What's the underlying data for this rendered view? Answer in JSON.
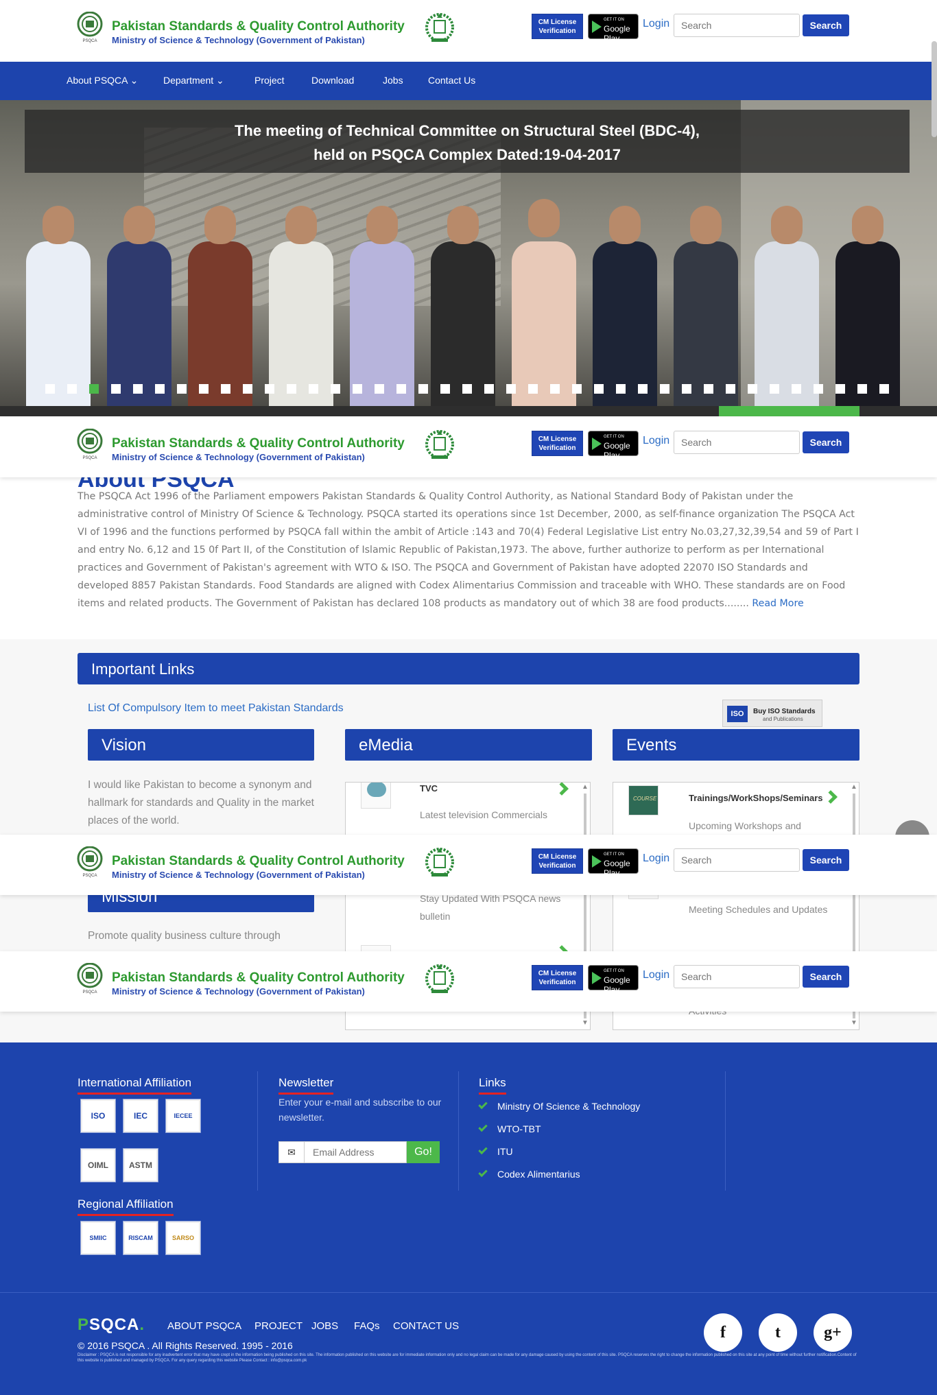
{
  "header": {
    "title": "Pakistan Standards & Quality Control Authority",
    "subtitle": "Ministry of Science & Technology (Government of Pakistan)",
    "emblem_label": "PSQCA",
    "cm_license": "CM License Verification",
    "gplay_small": "GET IT ON",
    "gplay_big": "Google Play",
    "login": "Login",
    "search_placeholder": "Search",
    "search_button": "Search"
  },
  "nav": {
    "items": [
      "About PSQCA",
      "Department",
      "Project",
      "Download",
      "Jobs",
      "Contact Us"
    ]
  },
  "slider": {
    "caption_line1": "The meeting of Technical Committee on Structural Steel  (BDC-4),",
    "caption_line2": "held on PSQCA Complex Dated:19-04-2017",
    "slide_count": 39,
    "active_slide_index": 2,
    "progress_fraction": 0.2
  },
  "about": {
    "title": "About PSQCA",
    "text": "The PSQCA Act 1996 of the Parliament empowers Pakistan Standards & Quality Control Authority, as National Standard Body of Pakistan under the administrative control of Ministry Of Science & Technology. PSQCA started its operations since 1st December, 2000, as self-finance organization The PSQCA Act VI of 1996 and the functions performed by PSQCA fall within the ambit of Article :143 and 70(4) Federal Legislative List entry No.03,27,32,39,54 and 59 of Part I and entry No. 6,12 and 15 0f Part II, of the Constitution of Islamic Republic of Pakistan,1973. The above, further authorize to perform as per International practices and Government of Pakistan's agreement with WTO & ISO. The PSQCA and Government of Pakistan have adopted 22070 ISO Standards and developed 8857 Pakistan Standards. Food Standards are aligned with Codex Alimentarius Commission and traceable with WHO. These standards are on Food items and related products. The Government of Pakistan has declared 108 products as mandatory out of which 38 are food products........ ",
    "read_more": "Read More"
  },
  "important_links": {
    "title": "Important Links",
    "compulsory_link": "List Of Compulsory Item to meet Pakistan Standards",
    "buy_iso_icon": "ISO",
    "buy_iso_line1": "Buy ISO Standards",
    "buy_iso_line2": "and Publications"
  },
  "vision": {
    "title": "Vision",
    "text": "I would like Pakistan to become a synonym and hallmark for standards and Quality in the market places of the world."
  },
  "mission": {
    "title": "Mission",
    "text": "Promote quality business culture through"
  },
  "emedia": {
    "title": "eMedia",
    "items": [
      {
        "title": "TVC",
        "desc": "Latest television Commercials"
      },
      {
        "desc": "Stay Updated With PSQCA news bulletin"
      }
    ]
  },
  "events": {
    "title": "Events",
    "items": [
      {
        "title": "Trainings/WorkShops/Seminars",
        "desc": "Upcoming Workshops and",
        "thumb": "COURSE"
      },
      {
        "desc": "Meeting Schedules and Updates"
      },
      {
        "desc": "Activities"
      }
    ]
  },
  "footer": {
    "intl_title": "International Affiliation",
    "intl_logos": [
      "ISO",
      "IEC",
      "IECEE",
      "OIML",
      "ASTM"
    ],
    "regional_title": "Regional Affiliation",
    "regional_logos": [
      "SMIIC",
      "RISCAM",
      "SARSO"
    ],
    "newsletter_title": "Newsletter",
    "newsletter_text": "Enter your e-mail and subscribe to our newsletter.",
    "email_placeholder": "Email Address",
    "go_label": "Go!",
    "links_title": "Links",
    "links": [
      "Ministry Of Science & Technology",
      "WTO-TBT",
      "ITU",
      "Codex Alimentarius"
    ],
    "brand": "PSQCA",
    "bottom_nav": [
      "ABOUT PSQCA",
      "PROJECT",
      "JOBS",
      "FAQs",
      "CONTACT US"
    ],
    "copyright": "© 2016 PSQCA . All Rights Reserved. 1995 - 2016",
    "disclaimer": "Disclaimer : PSQCA is not responsible for any inadvertent error that may have crept in the information being published on this site. The information published on this website are for immediate information only and no legal claim can be made for any damage caused by using the content of this site. PSQCA reserves the right to change the information published on this site at any point of time without further notification.Content of this website is published and managed by PSQCA. For any query regarding this website Please Contact : info@psqca.com.pk",
    "social": [
      "f",
      "t",
      "g+"
    ]
  },
  "colors": {
    "brand_blue": "#1d44ad",
    "brand_green": "#2d9a2f",
    "accent_green": "#4cb84a",
    "link_blue": "#2b6cc5"
  }
}
